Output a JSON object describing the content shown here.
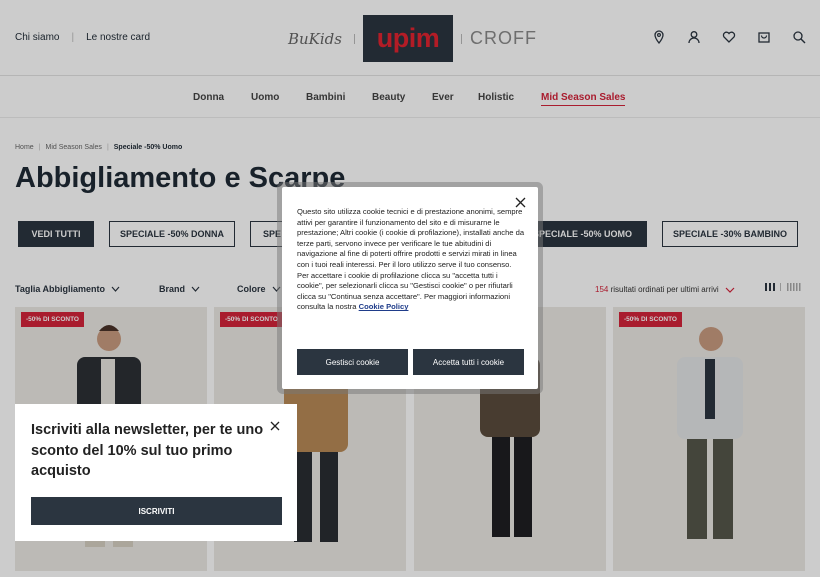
{
  "header": {
    "links": [
      "Chi siamo",
      "Le nostre card"
    ],
    "logos": {
      "bukids": "BuKids",
      "upim": "upim",
      "croff": "CROFF"
    },
    "icons": [
      "location-pin-icon",
      "user-icon",
      "heart-icon",
      "bag-icon",
      "search-icon"
    ]
  },
  "nav": [
    "Donna",
    "Uomo",
    "Bambini",
    "Beauty",
    "Ever",
    "Holistic",
    "Mid Season Sales"
  ],
  "breadcrumb": [
    "Home",
    "Mid Season Sales",
    "Speciale -50% Uomo"
  ],
  "page_title": "Abbigliamento e Scarpe",
  "filters": [
    "VEDI TUTTI",
    "SPECIALE -50% DONNA",
    "SPE",
    "SPECIALE -50% UOMO",
    "SPECIALE -30% BAMBINO"
  ],
  "sort": {
    "options": [
      "Taglia Abbigliamento",
      "Brand",
      "Colore"
    ],
    "count": "154",
    "results_text": "risultati ordinati per ultimi arrivi"
  },
  "products": [
    {
      "badge": "-50% DI SCONTO"
    },
    {
      "badge": "-50% DI SCONTO"
    },
    {
      "badge": ""
    },
    {
      "badge": "-50% DI SCONTO"
    }
  ],
  "cookie": {
    "text": "Questo sito utilizza cookie tecnici e di prestazione anonimi, sempre attivi per garantire il funzionamento del sito e di misurarne le prestazione; Altri cookie (i cookie di profilazione), installati anche da terze parti, servono invece per verificare le tue abitudini di navigazione al fine di poterti offrire prodotti e servizi mirati in linea con i tuoi reali interessi. Per il loro utilizzo serve il tuo consenso. Per accettare i cookie di profilazione clicca su \"accetta tutti i cookie\", per selezionarli clicca su \"Gestisci cookie\" o per rifiutarli clicca su \"Continua senza accettare\". Per maggiori informazioni consulta la nostra",
    "policy_link": "Cookie Policy",
    "manage_label": "Gestisci cookie",
    "accept_label": "Accetta tutti i cookie"
  },
  "newsletter": {
    "title": "Iscriviti alla newsletter, per te uno sconto del 10% sul tuo primo acquisto",
    "button": "ISCRIVITI"
  },
  "colors": {
    "accent": "#d4233a",
    "dark": "#2b3540"
  }
}
